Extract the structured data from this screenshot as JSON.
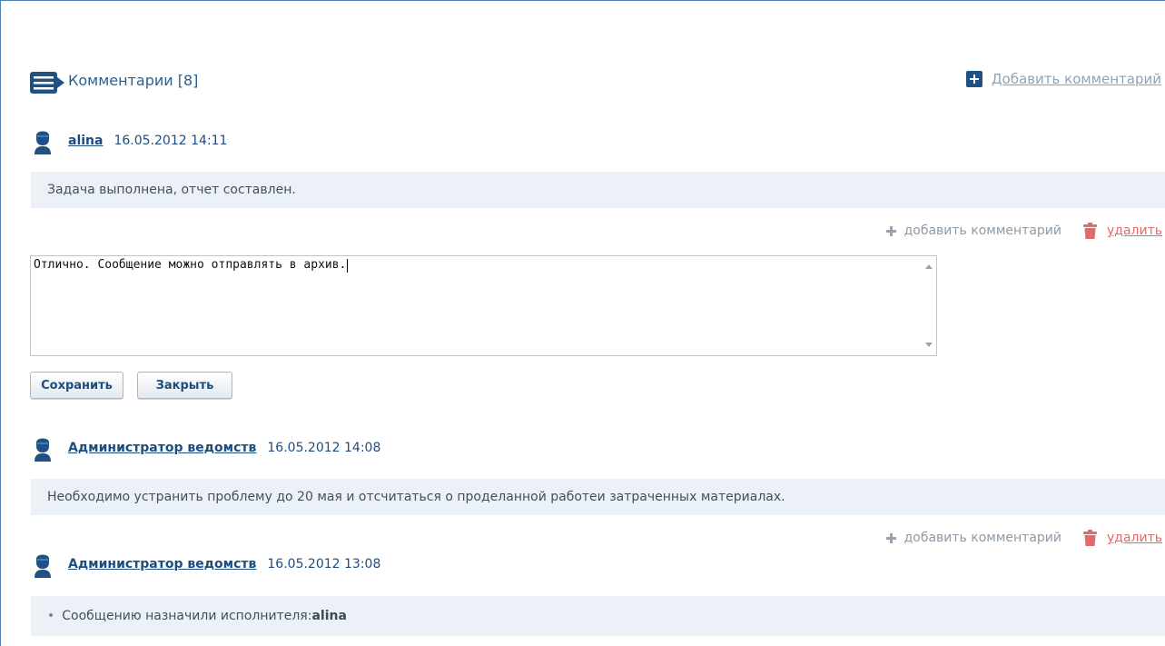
{
  "header": {
    "title": "Комментарии [8]",
    "icon": "comments-icon",
    "add_comment_label": "Добавить комментарий"
  },
  "comments": [
    {
      "author": "alina",
      "datetime": "16.05.2012 14:11",
      "text": "Задача выполнена, отчет составлен.",
      "add_reply_label": "добавить комментарий",
      "delete_label": "удалить"
    },
    {
      "author": "Администратор ведомств",
      "datetime": "16.05.2012 14:08",
      "text": "Необходимо устранить проблему до 20 мая и отсчитаться о проделанной работеи затраченных материалах.",
      "add_reply_label": "добавить комментарий",
      "delete_label": "удалить"
    },
    {
      "author": "Администратор ведомств",
      "datetime": "16.05.2012 13:08",
      "event_text": "Сообщению назначили исполнителя: ",
      "event_value": "alina"
    }
  ],
  "reply_form": {
    "value": "Отлично. Сообщение можно отправлять в архив.",
    "save_label": "Сохранить",
    "close_label": "Закрыть"
  },
  "colors": {
    "accent": "#1d4d80",
    "comment_background": "#ebf1f7",
    "delete": "#e06b6b"
  }
}
